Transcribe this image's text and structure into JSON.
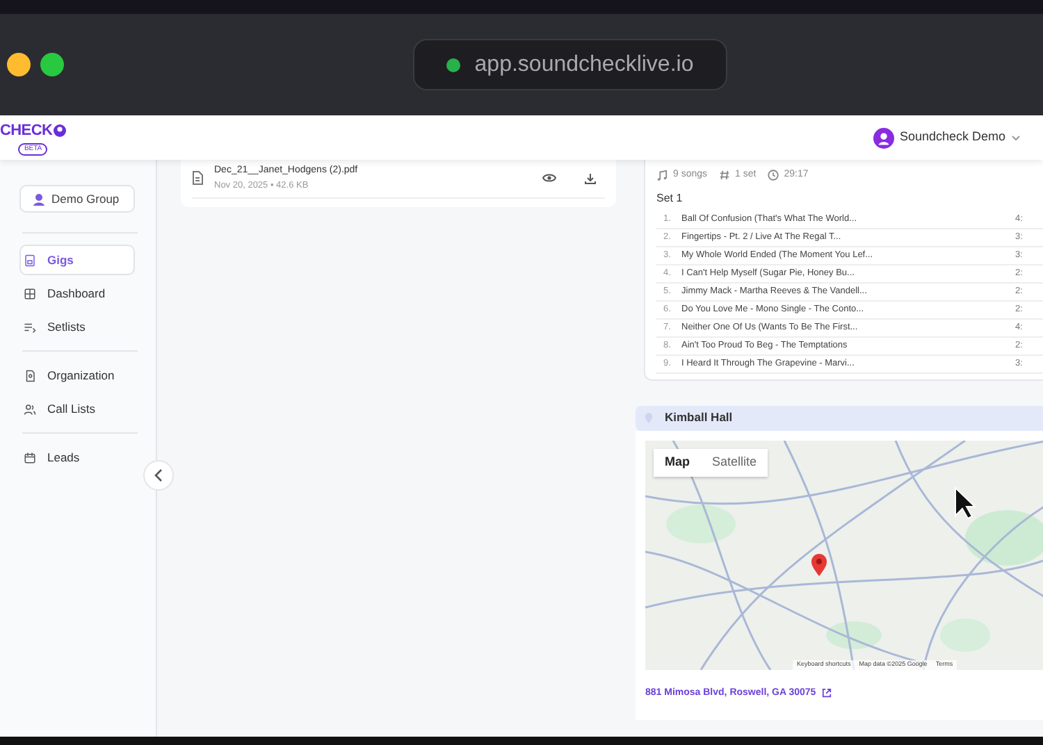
{
  "browser": {
    "window_buttons": [
      {
        "color": "#febc2e"
      },
      {
        "color": "#28c840"
      }
    ],
    "url": "app.soundchecklive.io"
  },
  "header": {
    "logo": "CHECK",
    "badge": "BETA",
    "account": "Soundcheck Demo"
  },
  "sidebar": {
    "group": "Demo Group",
    "sections": [
      [
        {
          "label": "Gigs",
          "kind": "gigs",
          "selected": true
        },
        {
          "label": "Dashboard",
          "kind": "dashboard",
          "selected": false
        },
        {
          "label": "Setlists",
          "kind": "setlists",
          "selected": false
        }
      ],
      [
        {
          "label": "Organization",
          "kind": "organization",
          "selected": false
        },
        {
          "label": "Call Lists",
          "kind": "people",
          "selected": false
        }
      ],
      [
        {
          "label": "Leads",
          "kind": "calendar",
          "selected": false
        }
      ]
    ]
  },
  "files": [
    {
      "name": "Dec_21__Janet_Hodgens (2).pdf",
      "meta": "Nov 20, 2025 • 42.6 KB"
    }
  ],
  "setlist": {
    "stats": [
      {
        "kind": "songs",
        "text": "9 songs"
      },
      {
        "kind": "sets",
        "text": "1 set"
      },
      {
        "kind": "time",
        "text": "29:17"
      }
    ],
    "set_title": "Set 1",
    "songs": [
      {
        "number": "1.",
        "title": "Ball Of Confusion (That's What The World...",
        "duration": "4:"
      },
      {
        "number": "2.",
        "title": "Fingertips - Pt. 2 / Live At The Regal T...",
        "duration": "3:"
      },
      {
        "number": "3.",
        "title": "My Whole World Ended (The Moment You Lef...",
        "duration": "3:"
      },
      {
        "number": "4.",
        "title": "I Can't Help Myself (Sugar Pie, Honey Bu...",
        "duration": "2:"
      },
      {
        "number": "5.",
        "title": "Jimmy Mack - Martha Reeves & The Vandell...",
        "duration": "2:"
      },
      {
        "number": "6.",
        "title": "Do You Love Me - Mono Single - The Conto...",
        "duration": "2:"
      },
      {
        "number": "7.",
        "title": "Neither One Of Us (Wants To Be The First...",
        "duration": "4:"
      },
      {
        "number": "8.",
        "title": "Ain't Too Proud To Beg - The Temptations",
        "duration": "2:"
      },
      {
        "number": "9.",
        "title": "I Heard It Through The Grapevine - Marvi...",
        "duration": "3:"
      }
    ]
  },
  "venue": {
    "name": "Kimball Hall",
    "map": {
      "view_options": [
        {
          "label": "Map",
          "selected": true
        },
        {
          "label": "Satellite",
          "selected": false
        }
      ],
      "attribution": [
        "Keyboard shortcuts",
        "Map data ©2025 Google",
        "Terms"
      ]
    },
    "address": "881 Mimosa Blvd, Roswell, GA 30075"
  }
}
